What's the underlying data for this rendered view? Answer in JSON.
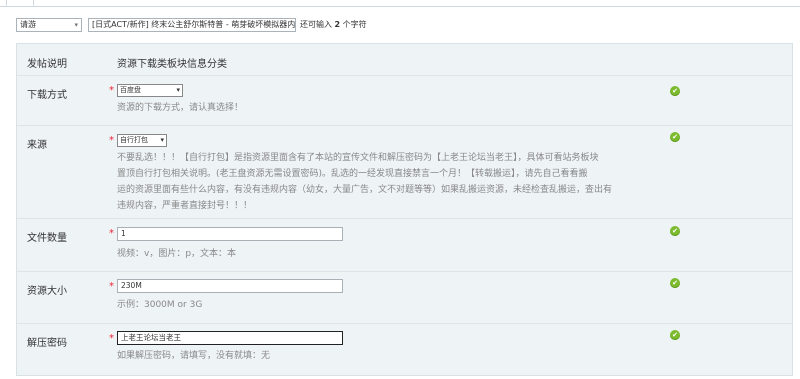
{
  "header": {
    "type_select": "请游",
    "title_value": "[日式ACT/新作] 终末公主舒尔斯特普 - 萌芽破坏模拟器内",
    "char_remaining_prefix": "还可输入",
    "char_remaining_count": "2",
    "char_remaining_suffix": "个字符"
  },
  "form": {
    "section_label": "发帖说明",
    "section_value": "资源下载类板块信息分类",
    "download": {
      "label": "下载方式",
      "required": "*",
      "selected": "百度盘",
      "hint": "资源的下载方式，请认真选择！"
    },
    "source": {
      "label": "来源",
      "required": "*",
      "selected": "自行打包",
      "hint_lines": [
        "不要乱选！！！【自行打包】是指资源里面含有了本站的宣传文件和解压密码为【上老王论坛当老王】，具体可看站务板块",
        "置顶自行打包相关说明。(老王盘资源无需设置密码)。乱选的一经发现直接禁言一个月！【转载搬运】，请先自己看看搬",
        "运的资源里面有些什么内容，有没有违规内容（幼女，大量广告，文不对题等等）如果乱搬运资源，未经检查乱搬运，查出有",
        "违规内容，严重者直接封号！！！"
      ]
    },
    "file_count": {
      "label": "文件数量",
      "required": "*",
      "value": "1",
      "hint": "视频：v，图片：p，文本：本"
    },
    "size": {
      "label": "资源大小",
      "required": "*",
      "value": "230M",
      "hint": "示例：3000M or 3G"
    },
    "password": {
      "label": "解压密码",
      "required": "*",
      "value": "上老王论坛当老王",
      "hint": "如果解压密码，请填写，没有就填：无"
    },
    "ok_mark": "✔"
  },
  "colors": {
    "ok_green": "#7dbb2e",
    "required_red": "#e23",
    "form_bg": "#eef3f6"
  }
}
